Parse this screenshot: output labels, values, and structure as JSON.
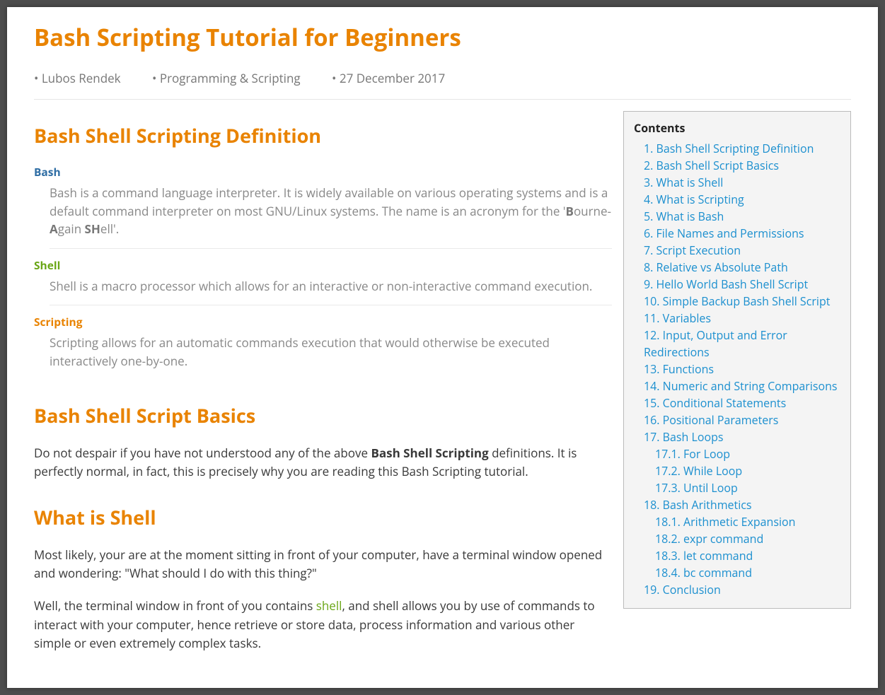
{
  "title": "Bash Scripting Tutorial for Beginners",
  "meta": {
    "author": "Lubos Rendek",
    "category": "Programming & Scripting",
    "date": "27 December 2017"
  },
  "sections": {
    "defn_heading": "Bash Shell Scripting Definition",
    "basics_heading": "Bash Shell Script Basics",
    "shell_heading": "What is Shell"
  },
  "definitions": {
    "bash": {
      "term": "Bash",
      "text_pre": "Bash is a command language interpreter. It is widely available on various operating systems and is a default command interpreter on most GNU/Linux systems. The name is an acronym for the '",
      "b1": "B",
      "mid1": "ourne-",
      "b2": "A",
      "mid2": "gain ",
      "b3": "SH",
      "tail": "ell'."
    },
    "shell": {
      "term": "Shell",
      "text": "Shell is a macro processor which allows for an interactive or non-interactive command execution."
    },
    "scripting": {
      "term": "Scripting",
      "text": "Scripting allows for an automatic commands execution that would otherwise be executed interactively one-by-one."
    }
  },
  "basics_para_pre": "Do not despair if you have not understood any of the above ",
  "basics_para_bold": "Bash Shell Scripting",
  "basics_para_post": " definitions. It is perfectly normal, in fact, this is precisely why you are reading this Bash Scripting tutorial.",
  "shell_p1": "Most likely, your are at the moment sitting in front of your computer, have a terminal window opened and wondering: \"What should I do with this thing?\"",
  "shell_p2_pre": "Well, the terminal window in front of you contains ",
  "shell_link": "shell",
  "shell_p2_post": ", and shell allows you by use of commands to interact with your computer, hence retrieve or store data, process information and various other simple or even extremely complex tasks.",
  "toc": {
    "title": "Contents",
    "items": [
      {
        "n": "1.",
        "label": "Bash Shell Scripting Definition",
        "sub": false
      },
      {
        "n": "2.",
        "label": "Bash Shell Script Basics",
        "sub": false
      },
      {
        "n": "3.",
        "label": "What is Shell",
        "sub": false
      },
      {
        "n": "4.",
        "label": "What is Scripting",
        "sub": false
      },
      {
        "n": "5.",
        "label": "What is Bash",
        "sub": false
      },
      {
        "n": "6.",
        "label": "File Names and Permissions",
        "sub": false
      },
      {
        "n": "7.",
        "label": "Script Execution",
        "sub": false
      },
      {
        "n": "8.",
        "label": "Relative vs Absolute Path",
        "sub": false
      },
      {
        "n": "9.",
        "label": "Hello World Bash Shell Script",
        "sub": false
      },
      {
        "n": "10.",
        "label": "Simple Backup Bash Shell Script",
        "sub": false
      },
      {
        "n": "11.",
        "label": "Variables",
        "sub": false
      },
      {
        "n": "12.",
        "label": "Input, Output and Error Redirections",
        "sub": false
      },
      {
        "n": "13.",
        "label": "Functions",
        "sub": false
      },
      {
        "n": "14.",
        "label": "Numeric and String Comparisons",
        "sub": false
      },
      {
        "n": "15.",
        "label": "Conditional Statements",
        "sub": false
      },
      {
        "n": "16.",
        "label": "Positional Parameters",
        "sub": false
      },
      {
        "n": "17.",
        "label": "Bash Loops",
        "sub": false
      },
      {
        "n": "17.1.",
        "label": "For Loop",
        "sub": true
      },
      {
        "n": "17.2.",
        "label": "While Loop",
        "sub": true
      },
      {
        "n": "17.3.",
        "label": "Until Loop",
        "sub": true
      },
      {
        "n": "18.",
        "label": "Bash Arithmetics",
        "sub": false
      },
      {
        "n": "18.1.",
        "label": "Arithmetic Expansion",
        "sub": true
      },
      {
        "n": "18.2.",
        "label": "expr command",
        "sub": true
      },
      {
        "n": "18.3.",
        "label": "let command",
        "sub": true
      },
      {
        "n": "18.4.",
        "label": "bc command",
        "sub": true
      },
      {
        "n": "19.",
        "label": "Conclusion",
        "sub": false
      }
    ]
  }
}
